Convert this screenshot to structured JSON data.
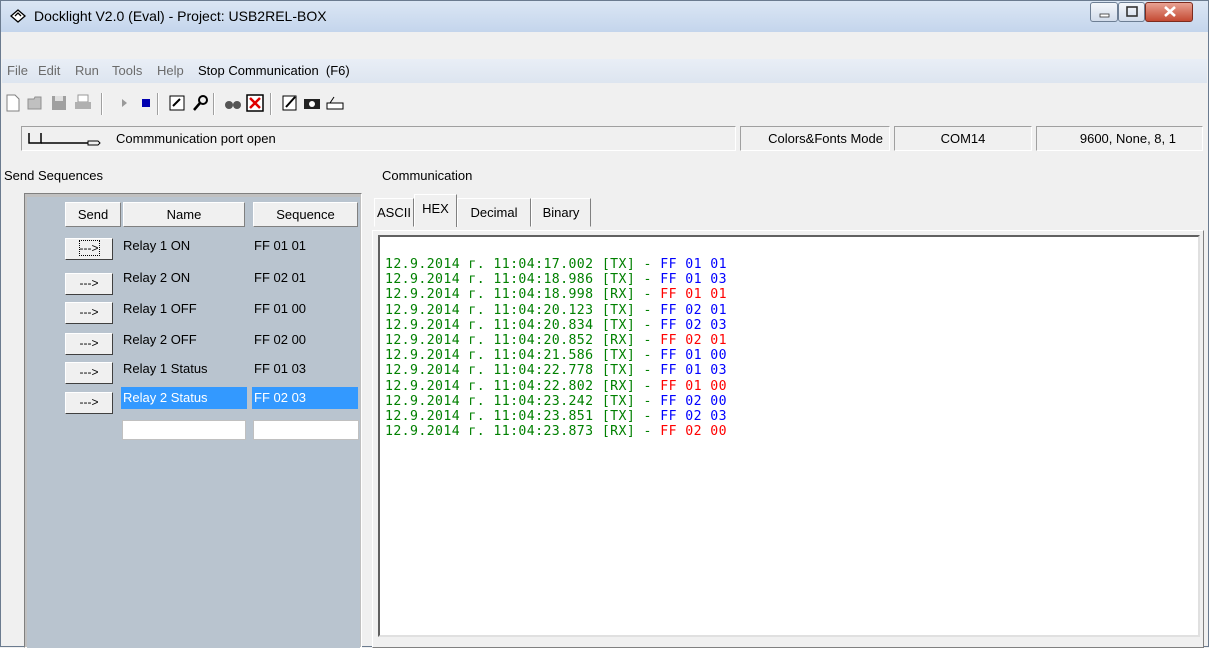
{
  "window": {
    "title": "Docklight V2.0 (Eval) - Project: USB2REL-BOX",
    "app_icon": "docklight-diamond-icon"
  },
  "menu": {
    "items": [
      "File",
      "Edit",
      "Run",
      "Tools",
      "Help"
    ],
    "stop_label": "Stop Communication  (F6)"
  },
  "toolbar": {
    "icons": [
      "new-icon",
      "open-icon",
      "save-icon",
      "print-icon",
      "run-icon",
      "stop-icon",
      "project-settings-icon",
      "keyboard-console-icon",
      "find-icon",
      "clear-icon",
      "edit-script-icon",
      "snapshot-icon",
      "keyboard-icon"
    ]
  },
  "status": {
    "port_state": "Commmunication port open",
    "mode": "Colors&Fonts Mode",
    "port": "COM14",
    "settings": "9600, None, 8, 1"
  },
  "send_panel": {
    "label": "Send Sequences",
    "headers": {
      "send": "Send",
      "name": "Name",
      "sequence": "Sequence"
    },
    "button_label": "--->",
    "rows": [
      {
        "name": "Relay 1 ON",
        "sequence": "FF 01 01"
      },
      {
        "name": "Relay 2 ON",
        "sequence": "FF 02 01"
      },
      {
        "name": "Relay 1 OFF",
        "sequence": "FF 01 00"
      },
      {
        "name": "Relay 2 OFF",
        "sequence": "FF 02 00"
      },
      {
        "name": "Relay 1 Status",
        "sequence": "FF 01 03"
      },
      {
        "name": "Relay 2 Status",
        "sequence": "FF 02 03"
      }
    ],
    "selected_row": 5
  },
  "comm_panel": {
    "label": "Communication",
    "tabs": [
      "ASCII",
      "HEX",
      "Decimal",
      "Binary"
    ],
    "active_tab": "HEX",
    "log": [
      {
        "ts": "12.9.2014 г. 11:04:17.002",
        "dir": "[TX]",
        "data": "FF 01 01"
      },
      {
        "ts": "12.9.2014 г. 11:04:18.986",
        "dir": "[TX]",
        "data": "FF 01 03"
      },
      {
        "ts": "12.9.2014 г. 11:04:18.998",
        "dir": "[RX]",
        "data": "FF 01 01"
      },
      {
        "ts": "12.9.2014 г. 11:04:20.123",
        "dir": "[TX]",
        "data": "FF 02 01"
      },
      {
        "ts": "12.9.2014 г. 11:04:20.834",
        "dir": "[TX]",
        "data": "FF 02 03"
      },
      {
        "ts": "12.9.2014 г. 11:04:20.852",
        "dir": "[RX]",
        "data": "FF 02 01"
      },
      {
        "ts": "12.9.2014 г. 11:04:21.586",
        "dir": "[TX]",
        "data": "FF 01 00"
      },
      {
        "ts": "12.9.2014 г. 11:04:22.778",
        "dir": "[TX]",
        "data": "FF 01 03"
      },
      {
        "ts": "12.9.2014 г. 11:04:22.802",
        "dir": "[RX]",
        "data": "FF 01 00"
      },
      {
        "ts": "12.9.2014 г. 11:04:23.242",
        "dir": "[TX]",
        "data": "FF 02 00"
      },
      {
        "ts": "12.9.2014 г. 11:04:23.851",
        "dir": "[TX]",
        "data": "FF 02 03"
      },
      {
        "ts": "12.9.2014 г. 11:04:23.873",
        "dir": "[RX]",
        "data": "FF 02 00"
      }
    ],
    "colors": {
      "timestamp": "#008000",
      "tx": "#0000ff",
      "rx": "#ff0000"
    }
  }
}
